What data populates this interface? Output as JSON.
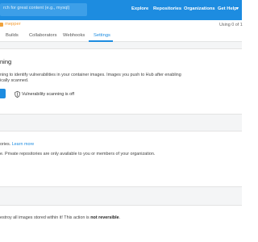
{
  "search": {
    "placeholder": "rch for great content (e.g., mysql)"
  },
  "nav": {
    "explore": "Explore",
    "repositories": "Repositories",
    "organizations": "Organizations",
    "help": "Get Help"
  },
  "repo": {
    "name": "mepper",
    "usage": "Using 0 of 1"
  },
  "tabs": [
    "Builds",
    "Collaborators",
    "Webhooks",
    "Settings"
  ],
  "scanning": {
    "title": "ning",
    "desc_line1": "ning to identify vulnerabilities in your container images. Images you push to Hub after enabling",
    "desc_line2": "ically scanned.",
    "status": "Vulnerability scanning is off"
  },
  "visibility": {
    "line1": "ories.",
    "learn_more": "Learn more",
    "line2": "e. Private repositories are only available to you or members of your organization."
  },
  "delete": {
    "text": "estroy all images stored within it! This action is",
    "bold": "not reversible",
    "end": "."
  },
  "colors": {
    "brand": "#1d8ce0",
    "accent_orange": "#f39c34",
    "band": "#f4f5f6"
  }
}
